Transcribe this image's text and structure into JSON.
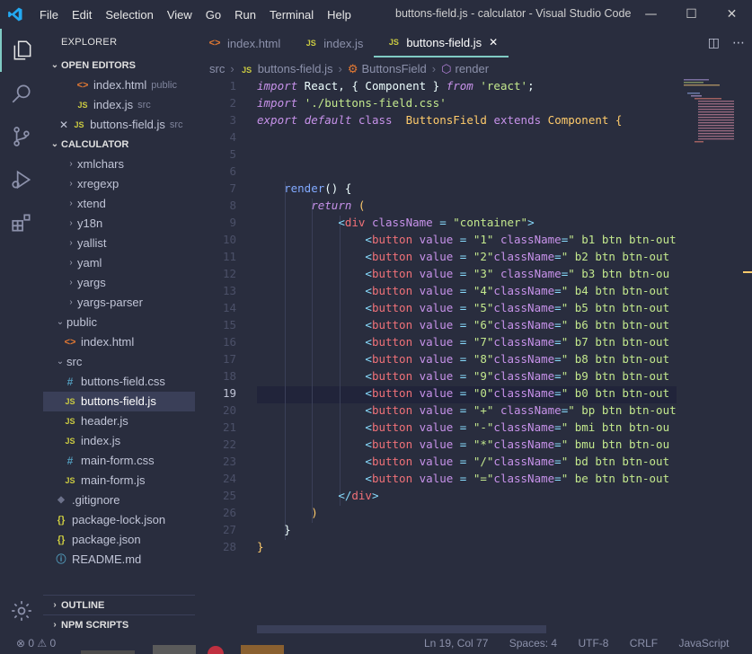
{
  "window": {
    "title": "buttons-field.js - calculator - Visual Studio Code",
    "menu": [
      "File",
      "Edit",
      "Selection",
      "View",
      "Go",
      "Run",
      "Terminal",
      "Help"
    ],
    "controls": [
      "—",
      "☐",
      "✕"
    ]
  },
  "activity": [
    "explorer-icon",
    "search-icon",
    "source-control-icon",
    "run-debug-icon",
    "extensions-icon",
    "settings-gear-icon"
  ],
  "sidebar": {
    "title": "EXPLORER",
    "open_editors_label": "OPEN EDITORS",
    "open_editors": [
      {
        "name": "index.html",
        "hint": "public",
        "type": "html"
      },
      {
        "name": "index.js",
        "hint": "src",
        "type": "js"
      },
      {
        "name": "buttons-field.js",
        "hint": "src",
        "type": "js"
      }
    ],
    "project_label": "CALCULATOR",
    "tree": [
      {
        "name": "xmlchars",
        "kind": "folder",
        "depth": 2
      },
      {
        "name": "xregexp",
        "kind": "folder",
        "depth": 2
      },
      {
        "name": "xtend",
        "kind": "folder",
        "depth": 2
      },
      {
        "name": "y18n",
        "kind": "folder",
        "depth": 2
      },
      {
        "name": "yallist",
        "kind": "folder",
        "depth": 2
      },
      {
        "name": "yaml",
        "kind": "folder",
        "depth": 2
      },
      {
        "name": "yargs",
        "kind": "folder",
        "depth": 2
      },
      {
        "name": "yargs-parser",
        "kind": "folder",
        "depth": 2
      },
      {
        "name": "public",
        "kind": "folder-open",
        "depth": 1
      },
      {
        "name": "index.html",
        "kind": "html",
        "depth": 2
      },
      {
        "name": "src",
        "kind": "folder-open",
        "depth": 1
      },
      {
        "name": "buttons-field.css",
        "kind": "css",
        "depth": 2
      },
      {
        "name": "buttons-field.js",
        "kind": "js",
        "depth": 2
      },
      {
        "name": "header.js",
        "kind": "js",
        "depth": 2
      },
      {
        "name": "index.js",
        "kind": "js",
        "depth": 2
      },
      {
        "name": "main-form.css",
        "kind": "css",
        "depth": 2
      },
      {
        "name": "main-form.js",
        "kind": "js",
        "depth": 2
      },
      {
        "name": ".gitignore",
        "kind": "git",
        "depth": 1
      },
      {
        "name": "package-lock.json",
        "kind": "json",
        "depth": 1
      },
      {
        "name": "package.json",
        "kind": "json",
        "depth": 1
      },
      {
        "name": "README.md",
        "kind": "info",
        "depth": 1
      }
    ],
    "outline_label": "OUTLINE",
    "npm_label": "NPM SCRIPTS"
  },
  "tabs": [
    {
      "name": "index.html",
      "type": "html",
      "active": false
    },
    {
      "name": "index.js",
      "type": "js",
      "active": false
    },
    {
      "name": "buttons-field.js",
      "type": "js",
      "active": true
    }
  ],
  "breadcrumbs": [
    "src",
    "buttons-field.js",
    "ButtonsField",
    "render"
  ],
  "code": {
    "current_line": 19,
    "lines": [
      [
        [
          "import",
          "k"
        ],
        [
          " React, { Component } ",
          "plain"
        ],
        [
          "from",
          "k"
        ],
        [
          " ",
          "plain"
        ],
        [
          "'react'",
          "s"
        ],
        [
          ";",
          "plain"
        ]
      ],
      [
        [
          "import",
          "k"
        ],
        [
          " ",
          "plain"
        ],
        [
          "'./buttons-field.css'",
          "s"
        ]
      ],
      [
        [
          "export",
          "k"
        ],
        [
          " ",
          "plain"
        ],
        [
          "default",
          "k"
        ],
        [
          " ",
          "plain"
        ],
        [
          "class",
          "kw"
        ],
        [
          "  ",
          "plain"
        ],
        [
          "ButtonsField",
          "c"
        ],
        [
          " ",
          "plain"
        ],
        [
          "extends",
          "kw"
        ],
        [
          " ",
          "plain"
        ],
        [
          "Component",
          "c"
        ],
        [
          " {",
          "c"
        ]
      ],
      [],
      [],
      [],
      [
        [
          "    ",
          "plain"
        ],
        [
          "render",
          "f"
        ],
        [
          "() {",
          "plain"
        ]
      ],
      [
        [
          "        ",
          "plain"
        ],
        [
          "return",
          "k"
        ],
        [
          " (",
          "c"
        ]
      ],
      [
        [
          "            ",
          "plain"
        ],
        [
          "<",
          "p"
        ],
        [
          "div",
          "t"
        ],
        [
          " className",
          "a"
        ],
        [
          " = ",
          "p"
        ],
        [
          "\"container\"",
          "s"
        ],
        [
          ">",
          "p"
        ]
      ],
      [
        [
          "                ",
          "plain"
        ],
        [
          "<",
          "p"
        ],
        [
          "button",
          "t"
        ],
        [
          " value",
          "a"
        ],
        [
          " = ",
          "p"
        ],
        [
          "\"1\"",
          "s"
        ],
        [
          " className",
          "a"
        ],
        [
          "=",
          "p"
        ],
        [
          "\" b1 btn btn-out",
          "s"
        ]
      ],
      [
        [
          "                ",
          "plain"
        ],
        [
          "<",
          "p"
        ],
        [
          "button",
          "t"
        ],
        [
          " value",
          "a"
        ],
        [
          " = ",
          "p"
        ],
        [
          "\"2\"",
          "s"
        ],
        [
          "className",
          "a"
        ],
        [
          "=",
          "p"
        ],
        [
          "\" b2 btn btn-out",
          "s"
        ]
      ],
      [
        [
          "                ",
          "plain"
        ],
        [
          "<",
          "p"
        ],
        [
          "button",
          "t"
        ],
        [
          " value",
          "a"
        ],
        [
          " = ",
          "p"
        ],
        [
          "\"3\"",
          "s"
        ],
        [
          " className",
          "a"
        ],
        [
          "=",
          "p"
        ],
        [
          "\" b3 btn btn-ou",
          "s"
        ]
      ],
      [
        [
          "                ",
          "plain"
        ],
        [
          "<",
          "p"
        ],
        [
          "button",
          "t"
        ],
        [
          " value",
          "a"
        ],
        [
          " = ",
          "p"
        ],
        [
          "\"4\"",
          "s"
        ],
        [
          "className",
          "a"
        ],
        [
          "=",
          "p"
        ],
        [
          "\" b4 btn btn-out",
          "s"
        ]
      ],
      [
        [
          "                ",
          "plain"
        ],
        [
          "<",
          "p"
        ],
        [
          "button",
          "t"
        ],
        [
          " value",
          "a"
        ],
        [
          " = ",
          "p"
        ],
        [
          "\"5\"",
          "s"
        ],
        [
          "className",
          "a"
        ],
        [
          "=",
          "p"
        ],
        [
          "\" b5 btn btn-out",
          "s"
        ]
      ],
      [
        [
          "                ",
          "plain"
        ],
        [
          "<",
          "p"
        ],
        [
          "button",
          "t"
        ],
        [
          " value",
          "a"
        ],
        [
          " = ",
          "p"
        ],
        [
          "\"6\"",
          "s"
        ],
        [
          "className",
          "a"
        ],
        [
          "=",
          "p"
        ],
        [
          "\" b6 btn btn-out",
          "s"
        ]
      ],
      [
        [
          "                ",
          "plain"
        ],
        [
          "<",
          "p"
        ],
        [
          "button",
          "t"
        ],
        [
          " value",
          "a"
        ],
        [
          " = ",
          "p"
        ],
        [
          "\"7\"",
          "s"
        ],
        [
          "className",
          "a"
        ],
        [
          "=",
          "p"
        ],
        [
          "\" b7 btn btn-out",
          "s"
        ]
      ],
      [
        [
          "                ",
          "plain"
        ],
        [
          "<",
          "p"
        ],
        [
          "button",
          "t"
        ],
        [
          " value",
          "a"
        ],
        [
          " = ",
          "p"
        ],
        [
          "\"8\"",
          "s"
        ],
        [
          "className",
          "a"
        ],
        [
          "=",
          "p"
        ],
        [
          "\" b8 btn btn-out",
          "s"
        ]
      ],
      [
        [
          "                ",
          "plain"
        ],
        [
          "<",
          "p"
        ],
        [
          "button",
          "t"
        ],
        [
          " value",
          "a"
        ],
        [
          " = ",
          "p"
        ],
        [
          "\"9\"",
          "s"
        ],
        [
          "className",
          "a"
        ],
        [
          "=",
          "p"
        ],
        [
          "\" b9 btn btn-out",
          "s"
        ]
      ],
      [
        [
          "                ",
          "plain"
        ],
        [
          "<",
          "p"
        ],
        [
          "button",
          "t"
        ],
        [
          " value",
          "a"
        ],
        [
          " = ",
          "p"
        ],
        [
          "\"0\"",
          "s"
        ],
        [
          "className",
          "a"
        ],
        [
          "=",
          "p"
        ],
        [
          "\" b0 btn btn-out",
          "s"
        ]
      ],
      [
        [
          "                ",
          "plain"
        ],
        [
          "<",
          "p"
        ],
        [
          "button",
          "t"
        ],
        [
          " value",
          "a"
        ],
        [
          " = ",
          "p"
        ],
        [
          "\"+\"",
          "s"
        ],
        [
          " className",
          "a"
        ],
        [
          "=",
          "p"
        ],
        [
          "\" bp btn btn-out",
          "s"
        ]
      ],
      [
        [
          "                ",
          "plain"
        ],
        [
          "<",
          "p"
        ],
        [
          "button",
          "t"
        ],
        [
          " value",
          "a"
        ],
        [
          " = ",
          "p"
        ],
        [
          "\"-\"",
          "s"
        ],
        [
          "className",
          "a"
        ],
        [
          "=",
          "p"
        ],
        [
          "\" bmi btn btn-ou",
          "s"
        ]
      ],
      [
        [
          "                ",
          "plain"
        ],
        [
          "<",
          "p"
        ],
        [
          "button",
          "t"
        ],
        [
          " value",
          "a"
        ],
        [
          " = ",
          "p"
        ],
        [
          "\"*\"",
          "s"
        ],
        [
          "className",
          "a"
        ],
        [
          "=",
          "p"
        ],
        [
          "\" bmu btn btn-ou",
          "s"
        ]
      ],
      [
        [
          "                ",
          "plain"
        ],
        [
          "<",
          "p"
        ],
        [
          "button",
          "t"
        ],
        [
          " value",
          "a"
        ],
        [
          " = ",
          "p"
        ],
        [
          "\"/\"",
          "s"
        ],
        [
          "className",
          "a"
        ],
        [
          "=",
          "p"
        ],
        [
          "\" bd btn btn-out",
          "s"
        ]
      ],
      [
        [
          "                ",
          "plain"
        ],
        [
          "<",
          "p"
        ],
        [
          "button",
          "t"
        ],
        [
          " value",
          "a"
        ],
        [
          " = ",
          "p"
        ],
        [
          "\"=\"",
          "s"
        ],
        [
          "className",
          "a"
        ],
        [
          "=",
          "p"
        ],
        [
          "\" be btn btn-out",
          "s"
        ]
      ],
      [
        [
          "            ",
          "plain"
        ],
        [
          "</",
          "p"
        ],
        [
          "div",
          "t"
        ],
        [
          ">",
          "p"
        ]
      ],
      [
        [
          "        ",
          "plain"
        ],
        [
          ")",
          "c"
        ]
      ],
      [
        [
          "    ",
          "plain"
        ],
        [
          "}",
          "plain"
        ]
      ],
      [
        [
          "}",
          "c"
        ]
      ]
    ]
  },
  "status": {
    "problems": "⊗ 0  ⚠ 0",
    "position": "Ln 19, Col 77",
    "spaces": "Spaces: 4",
    "encoding": "UTF-8",
    "eol": "CRLF",
    "language": "JavaScript"
  },
  "colors": {
    "accent": "#80cbc4",
    "background": "#292d3e"
  }
}
